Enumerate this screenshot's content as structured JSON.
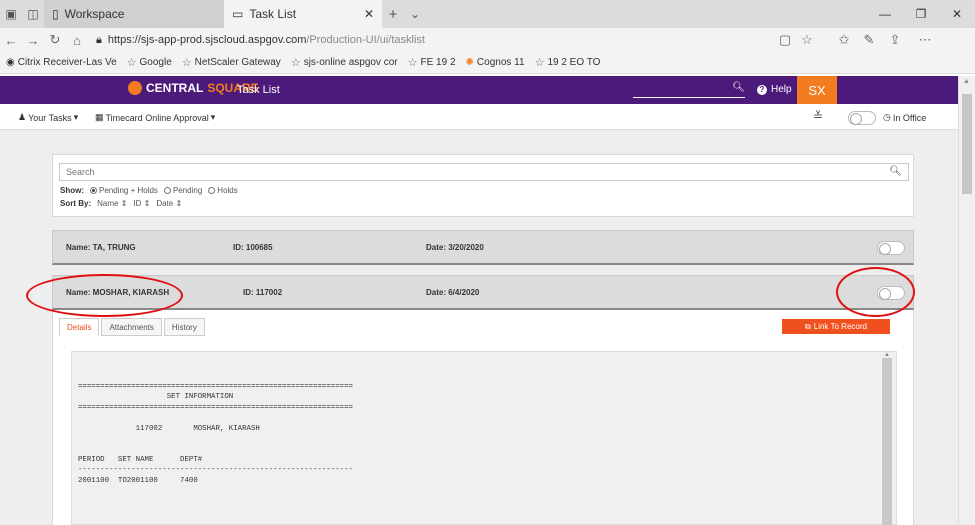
{
  "browser": {
    "tabs": [
      {
        "label": "Workspace",
        "active": false
      },
      {
        "label": "Task List",
        "active": true
      }
    ],
    "url_host": "https://sjs-app-prod.sjscloud.aspgov.com",
    "url_path": "/Production-UI/ui/tasklist",
    "favorites": [
      "Citrix Receiver-Las Ve",
      "Google",
      "NetScaler Gateway",
      "sjs-online aspgov cor",
      "FE 19 2",
      "Cognos 11",
      "19 2 EO TO"
    ]
  },
  "app": {
    "logo_text": "CENTRAL",
    "logo_accent": "SQUARE",
    "title": "Task List",
    "help_label": "Help",
    "avatar_initials": "SX"
  },
  "subnav": {
    "your_tasks": "Your Tasks",
    "timecard": "Timecard Online Approval",
    "in_office": "In Office"
  },
  "search": {
    "placeholder": "Search",
    "show_label": "Show:",
    "show_options": [
      "Pending + Holds",
      "Pending",
      "Holds"
    ],
    "show_selected": "Pending + Holds",
    "sort_label": "Sort By:",
    "sort_fields": [
      "Name",
      "ID",
      "Date"
    ]
  },
  "tasks": [
    {
      "name": "Name: TA, TRUNG",
      "id": "ID: 100685",
      "date": "Date: 3/20/2020"
    },
    {
      "name": "Name: MOSHAR, KIARASH",
      "id": "ID: 117002",
      "date": "Date: 6/4/2020"
    }
  ],
  "detail": {
    "tabs": [
      "Details",
      "Attachments",
      "History"
    ],
    "active_tab": "Details",
    "link_button": "Link To Record",
    "report_text": "==============================================================\n                    SET INFORMATION\n==============================================================\n\n             117002       MOSHAR, KIARASH\n\n\nPERIOD   SET NAME      DEPT#\n--------------------------------------------------------------\n2001100  TO2001100     7400"
  },
  "colors": {
    "header_purple": "#4b1a7a",
    "accent_orange": "#f47c20",
    "link_button": "#f0501e",
    "annotation_red": "#e01010"
  }
}
